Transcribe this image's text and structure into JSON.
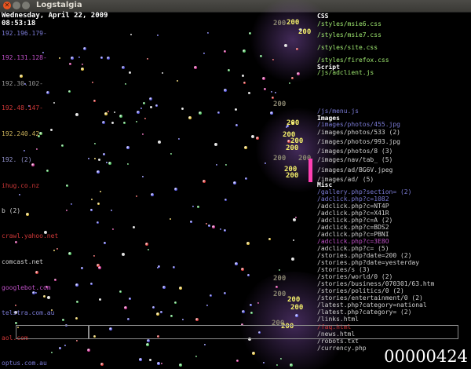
{
  "window": {
    "title": "Logstalgia"
  },
  "header": {
    "date": "Wednesday, April 22, 2009",
    "time": "08:53:18"
  },
  "counter": "00000424",
  "hosts": [
    {
      "label": "192.196.179-",
      "color": "#7b7bd6"
    },
    {
      "label": "192.131.128-",
      "color": "#c050c8"
    },
    {
      "label": "192.30.102-",
      "color": "#9a9a9a"
    },
    {
      "label": "192.48.147-",
      "color": "#d03838"
    },
    {
      "label": "192.240.42-",
      "color": "#c8b05a"
    },
    {
      "label": "192. (2)",
      "color": "#8f8fc8"
    },
    {
      "label": "ihug.co.nz",
      "color": "#d03838"
    },
    {
      "label": "b (2)",
      "color": "#cfcfcf"
    },
    {
      "label": "crawl.yahoo.net",
      "color": "#d03838"
    },
    {
      "label": "comcast.net",
      "color": "#cfcfcf"
    },
    {
      "label": "googlebot.com",
      "color": "#c050c8"
    },
    {
      "label": "telstra.com.au",
      "color": "#7b7bd6"
    },
    {
      "label": "aol.com",
      "color": "#d03838"
    },
    {
      "label": "optus.com.au",
      "color": "#7b7bd6"
    }
  ],
  "paths": [
    {
      "type": "cat",
      "label": "CSS"
    },
    {
      "type": "path",
      "label": "/styles/msie6.css",
      "color": "#9fe870"
    },
    {
      "type": "path",
      "label": "/styles/msie7.css",
      "color": "#9fe870"
    },
    {
      "type": "path",
      "label": "/styles/site.css",
      "color": "#9fe870"
    },
    {
      "type": "path",
      "label": "/styles/firefox.css",
      "color": "#9fe870"
    },
    {
      "type": "cat",
      "label": "Script"
    },
    {
      "type": "path",
      "label": "/js/adclient.js",
      "color": "#9fe870"
    },
    {
      "type": "path",
      "label": "/js/menu.js",
      "color": "#7b7bd6"
    },
    {
      "type": "cat",
      "label": "Images"
    },
    {
      "type": "path",
      "label": "/images/photos/455.jpg",
      "color": "#7b7bd6"
    },
    {
      "type": "path",
      "label": "/images/photos/533 (2)",
      "color": "#cfcfcf"
    },
    {
      "type": "path",
      "label": "/images/photos/993.jpg",
      "color": "#cfcfcf"
    },
    {
      "type": "path",
      "label": "/images/photos/8 (3)",
      "color": "#cfcfcf"
    },
    {
      "type": "path",
      "label": "/images/nav/tab_ (5)",
      "color": "#cfcfcf"
    },
    {
      "type": "path",
      "label": "/images/ad/BG6V.jpeg",
      "color": "#cfcfcf"
    },
    {
      "type": "path",
      "label": "/images/ad/ (5)",
      "color": "#cfcfcf"
    },
    {
      "type": "cat",
      "label": "Misc"
    },
    {
      "type": "path",
      "label": "/gallery.php?section= (2)",
      "color": "#7b7bd6"
    },
    {
      "type": "path",
      "label": "/adclick.php?c=1082",
      "color": "#7b7bd6"
    },
    {
      "type": "path",
      "label": "/adclick.php?c=NT4P",
      "color": "#cfcfcf"
    },
    {
      "type": "path",
      "label": "/adclick.php?c=X41R",
      "color": "#cfcfcf"
    },
    {
      "type": "path",
      "label": "/adclick.php?c=A (2)",
      "color": "#cfcfcf"
    },
    {
      "type": "path",
      "label": "/adclick.php?c=BDS2",
      "color": "#cfcfcf"
    },
    {
      "type": "path",
      "label": "/adclick.php?c=PBNI",
      "color": "#cfcfcf"
    },
    {
      "type": "path",
      "label": "/adclick.php?c=3E8O",
      "color": "#c050c8"
    },
    {
      "type": "path",
      "label": "/adclick.php?c= (5)",
      "color": "#cfcfcf"
    },
    {
      "type": "path",
      "label": "/stories.php?date=200 (2)",
      "color": "#cfcfcf"
    },
    {
      "type": "path",
      "label": "/stories.php?date=yesterday",
      "color": "#cfcfcf"
    },
    {
      "type": "path",
      "label": "/stories/s (3)",
      "color": "#cfcfcf"
    },
    {
      "type": "path",
      "label": "/stories/world/0 (2)",
      "color": "#cfcfcf"
    },
    {
      "type": "path",
      "label": "/stories/business/070301/63.htm",
      "color": "#cfcfcf"
    },
    {
      "type": "path",
      "label": "/stories/politics/0 (2)",
      "color": "#cfcfcf"
    },
    {
      "type": "path",
      "label": "/stories/entertainment/0 (2)",
      "color": "#cfcfcf"
    },
    {
      "type": "path",
      "label": "/latest.php?category=national",
      "color": "#cfcfcf"
    },
    {
      "type": "path",
      "label": "/latest.php?category= (2)",
      "color": "#cfcfcf"
    },
    {
      "type": "path",
      "label": "/links.html",
      "color": "#cfcfcf"
    },
    {
      "type": "path",
      "label": "/faq.html",
      "color": "#d03838"
    },
    {
      "type": "path",
      "label": "/news.html",
      "color": "#cfcfcf"
    },
    {
      "type": "path",
      "label": "/robots.txt",
      "color": "#cfcfcf"
    },
    {
      "type": "path",
      "label": "/currency.php",
      "color": "#cfcfcf"
    }
  ],
  "response_codes": [
    {
      "label": "200",
      "lit": true
    },
    {
      "label": "200",
      "lit": false
    },
    {
      "label": "200",
      "lit": true
    },
    {
      "label": "200",
      "lit": false
    },
    {
      "label": "200",
      "lit": true
    },
    {
      "label": "200",
      "lit": true
    },
    {
      "label": "200",
      "lit": true
    },
    {
      "label": "200",
      "lit": true
    },
    {
      "label": "200",
      "lit": false
    },
    {
      "label": "200",
      "lit": false
    },
    {
      "label": "200",
      "lit": true
    },
    {
      "label": "200",
      "lit": true
    },
    {
      "label": "200",
      "lit": false
    },
    {
      "label": "200",
      "lit": false
    },
    {
      "label": "200",
      "lit": true
    },
    {
      "label": "200",
      "lit": true
    },
    {
      "label": "200",
      "lit": false
    },
    {
      "label": "200",
      "lit": true
    }
  ]
}
